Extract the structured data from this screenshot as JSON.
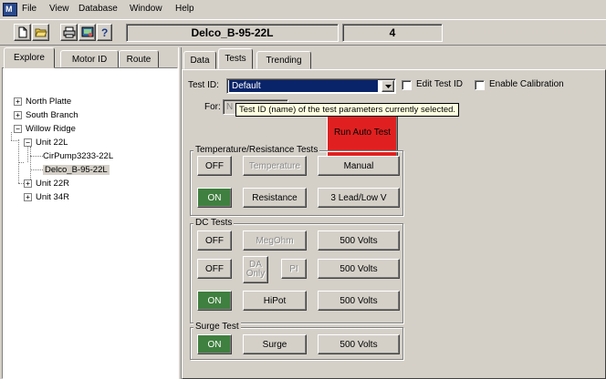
{
  "menu": {
    "items": [
      "File",
      "View",
      "Database",
      "Window",
      "Help"
    ]
  },
  "toolbar": {
    "buttons": [
      "new-icon",
      "open-icon",
      "print-icon",
      "config-icon",
      "help-icon"
    ],
    "motor_name": "Delco_B-95-22L",
    "count": "4"
  },
  "left_tabs": [
    "Explore",
    "Motor ID",
    "Route"
  ],
  "tree": {
    "north_platte": "North Platte",
    "south_branch": "South Branch",
    "willow_ridge": "Willow Ridge",
    "unit_22l": "Unit 22L",
    "cirpump": "CirPump3233-22L",
    "delco": "Delco_B-95-22L",
    "unit_22r": "Unit 22R",
    "unit_34r": "Unit 34R",
    "expander_plus": "+",
    "expander_minus": "−"
  },
  "right_tabs": [
    "Data",
    "Tests",
    "Trending"
  ],
  "test_id": {
    "label": "Test ID:",
    "value": "Default",
    "edit_label": "Edit Test ID",
    "calib_label": "Enable Calibration"
  },
  "for": {
    "label": "For:",
    "value": "N"
  },
  "tooltip": "Test ID (name) of the test parameters currently selected.",
  "run_auto_test": "Run Auto Test",
  "temp_group": {
    "title": "Temperature/Resistance Tests",
    "row1": {
      "state": "OFF",
      "test": "Temperature",
      "mode": "Manual"
    },
    "row2": {
      "state": "ON",
      "test": "Resistance",
      "mode": "3 Lead/Low V"
    }
  },
  "dc_group": {
    "title": "DC Tests",
    "row1": {
      "state": "OFF",
      "test": "MegOhm",
      "volts": "500 Volts"
    },
    "row2": {
      "state": "OFF",
      "test_da_1": "DA",
      "test_da_2": "Only",
      "test_pi": "PI",
      "volts": "500 Volts"
    },
    "row3": {
      "state": "ON",
      "test": "HiPot",
      "volts": "500 Volts"
    }
  },
  "surge_group": {
    "title": "Surge Test",
    "row1": {
      "state": "ON",
      "test": "Surge",
      "volts": "500 Volts"
    }
  },
  "colors": {
    "on_green": "#3f7f3f",
    "run_red": "#e02020",
    "selection": "#0a246a",
    "tooltip_bg": "#ffffe1"
  }
}
